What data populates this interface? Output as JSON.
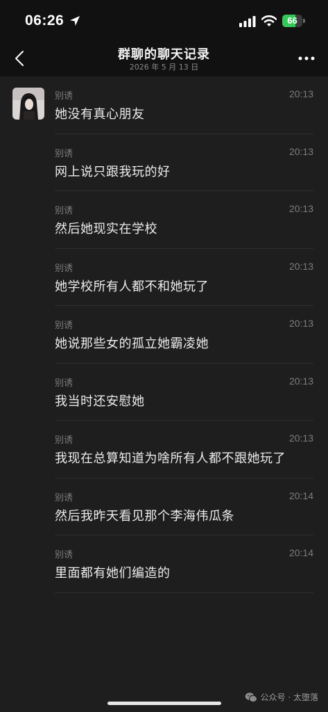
{
  "status_bar": {
    "time": "06:26",
    "battery_level": "66",
    "battery_fraction": 0.66
  },
  "header": {
    "title": "群聊的聊天记录",
    "subtitle": "2026 年 5 月 13 日"
  },
  "messages": [
    {
      "sender": "别诱",
      "time": "20:13",
      "text": "她没有真心朋友",
      "show_avatar": true
    },
    {
      "sender": "别诱",
      "time": "20:13",
      "text": "网上说只跟我玩的好",
      "show_avatar": false
    },
    {
      "sender": "别诱",
      "time": "20:13",
      "text": "然后她现实在学校",
      "show_avatar": false
    },
    {
      "sender": "别诱",
      "time": "20:13",
      "text": "她学校所有人都不和她玩了",
      "show_avatar": false
    },
    {
      "sender": "别诱",
      "time": "20:13",
      "text": "她说那些女的孤立她霸凌她",
      "show_avatar": false
    },
    {
      "sender": "别诱",
      "time": "20:13",
      "text": "我当时还安慰她",
      "show_avatar": false
    },
    {
      "sender": "别诱",
      "time": "20:13",
      "text": "我现在总算知道为啥所有人都不跟她玩了",
      "show_avatar": false
    },
    {
      "sender": "别诱",
      "time": "20:14",
      "text": "然后我昨天看见那个李海伟瓜条",
      "show_avatar": false
    },
    {
      "sender": "别诱",
      "time": "20:14",
      "text": "里面都有她们编造的",
      "show_avatar": false
    }
  ],
  "watermark": {
    "text": "公众号 · 太堕落"
  },
  "icons": {
    "location": "location-arrow-icon",
    "signal": "cellular-signal-icon",
    "wifi": "wifi-icon",
    "back": "chevron-left-icon",
    "more": "more-dots-icon",
    "watermark": "wechat-logo-icon"
  },
  "colors": {
    "background": "#1e1e1e",
    "header_background": "#111111",
    "battery_green": "#35c759",
    "message_text": "#ececec",
    "meta_text": "#7d7d7d"
  }
}
